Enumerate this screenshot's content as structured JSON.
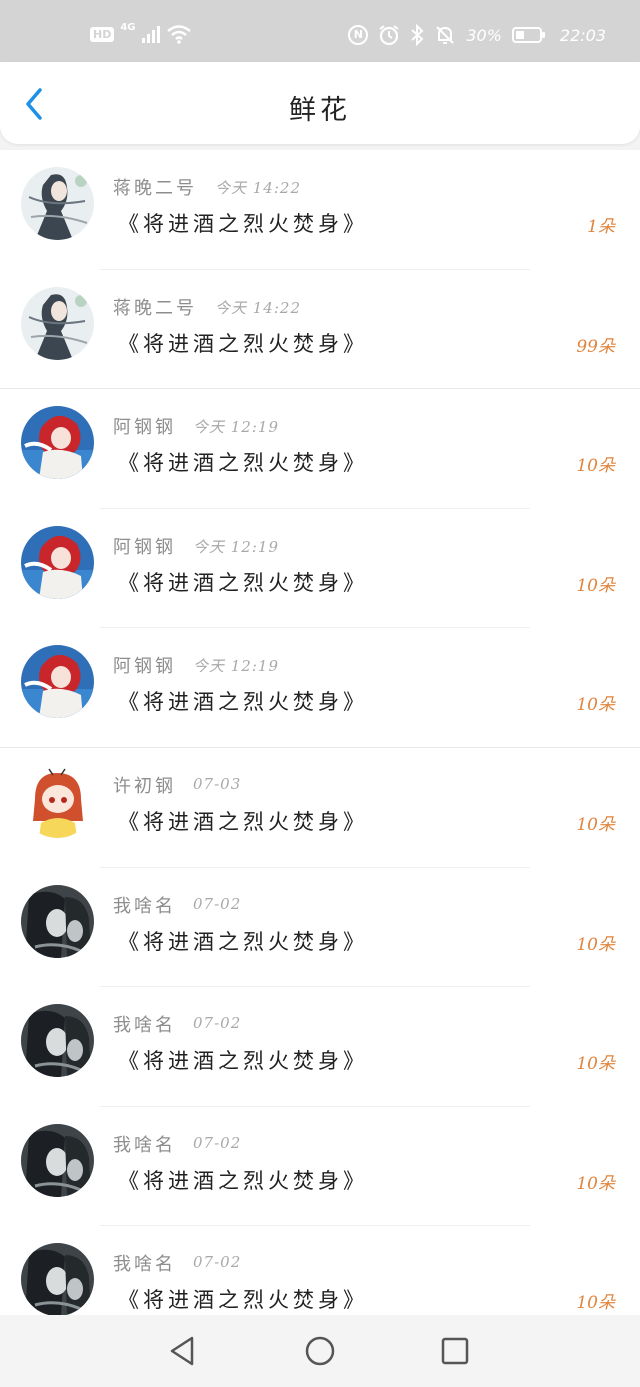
{
  "status_bar": {
    "hd": "HD",
    "network": "4G",
    "nfc": "N",
    "battery_percent": "30%",
    "time": "22:03",
    "icons": [
      "signal-icon",
      "wifi-icon",
      "nfc-icon",
      "alarm-icon",
      "bluetooth-icon",
      "mute-icon",
      "battery-icon"
    ]
  },
  "header": {
    "back_icon": "chevron-left-icon",
    "title": "鲜花"
  },
  "colors": {
    "accent": "#1e90e6",
    "count": "#e0843d",
    "status_bar_bg": "#d4d4d4"
  },
  "records": [
    {
      "name": "蒋晚二号",
      "time": "今天 14:22",
      "book": "《将进酒之烈火焚身》",
      "count": "1朵",
      "avatar": "avatar-ink-scholar"
    },
    {
      "name": "蒋晚二号",
      "time": "今天 14:22",
      "book": "《将进酒之烈火焚身》",
      "count": "99朵",
      "avatar": "avatar-ink-scholar"
    },
    {
      "name": "阿钢钢",
      "time": "今天 12:19",
      "book": "《将进酒之烈火焚身》",
      "count": "10朵",
      "avatar": "avatar-red-hair"
    },
    {
      "name": "阿钢钢",
      "time": "今天 12:19",
      "book": "《将进酒之烈火焚身》",
      "count": "10朵",
      "avatar": "avatar-red-hair"
    },
    {
      "name": "阿钢钢",
      "time": "今天 12:19",
      "book": "《将进酒之烈火焚身》",
      "count": "10朵",
      "avatar": "avatar-red-hair"
    },
    {
      "name": "许初钢",
      "time": "07-03",
      "book": "《将进酒之烈火焚身》",
      "count": "10朵",
      "avatar": "avatar-chibi-girl"
    },
    {
      "name": "我啥名",
      "time": "07-02",
      "book": "《将进酒之烈火焚身》",
      "count": "10朵",
      "avatar": "avatar-dark-portrait"
    },
    {
      "name": "我啥名",
      "time": "07-02",
      "book": "《将进酒之烈火焚身》",
      "count": "10朵",
      "avatar": "avatar-dark-portrait"
    },
    {
      "name": "我啥名",
      "time": "07-02",
      "book": "《将进酒之烈火焚身》",
      "count": "10朵",
      "avatar": "avatar-dark-portrait"
    },
    {
      "name": "我啥名",
      "time": "07-02",
      "book": "《将进酒之烈火焚身》",
      "count": "10朵",
      "avatar": "avatar-dark-portrait"
    }
  ],
  "nav_bar": {
    "back_icon": "triangle-back-icon",
    "home_icon": "circle-home-icon",
    "recents_icon": "square-recents-icon"
  }
}
